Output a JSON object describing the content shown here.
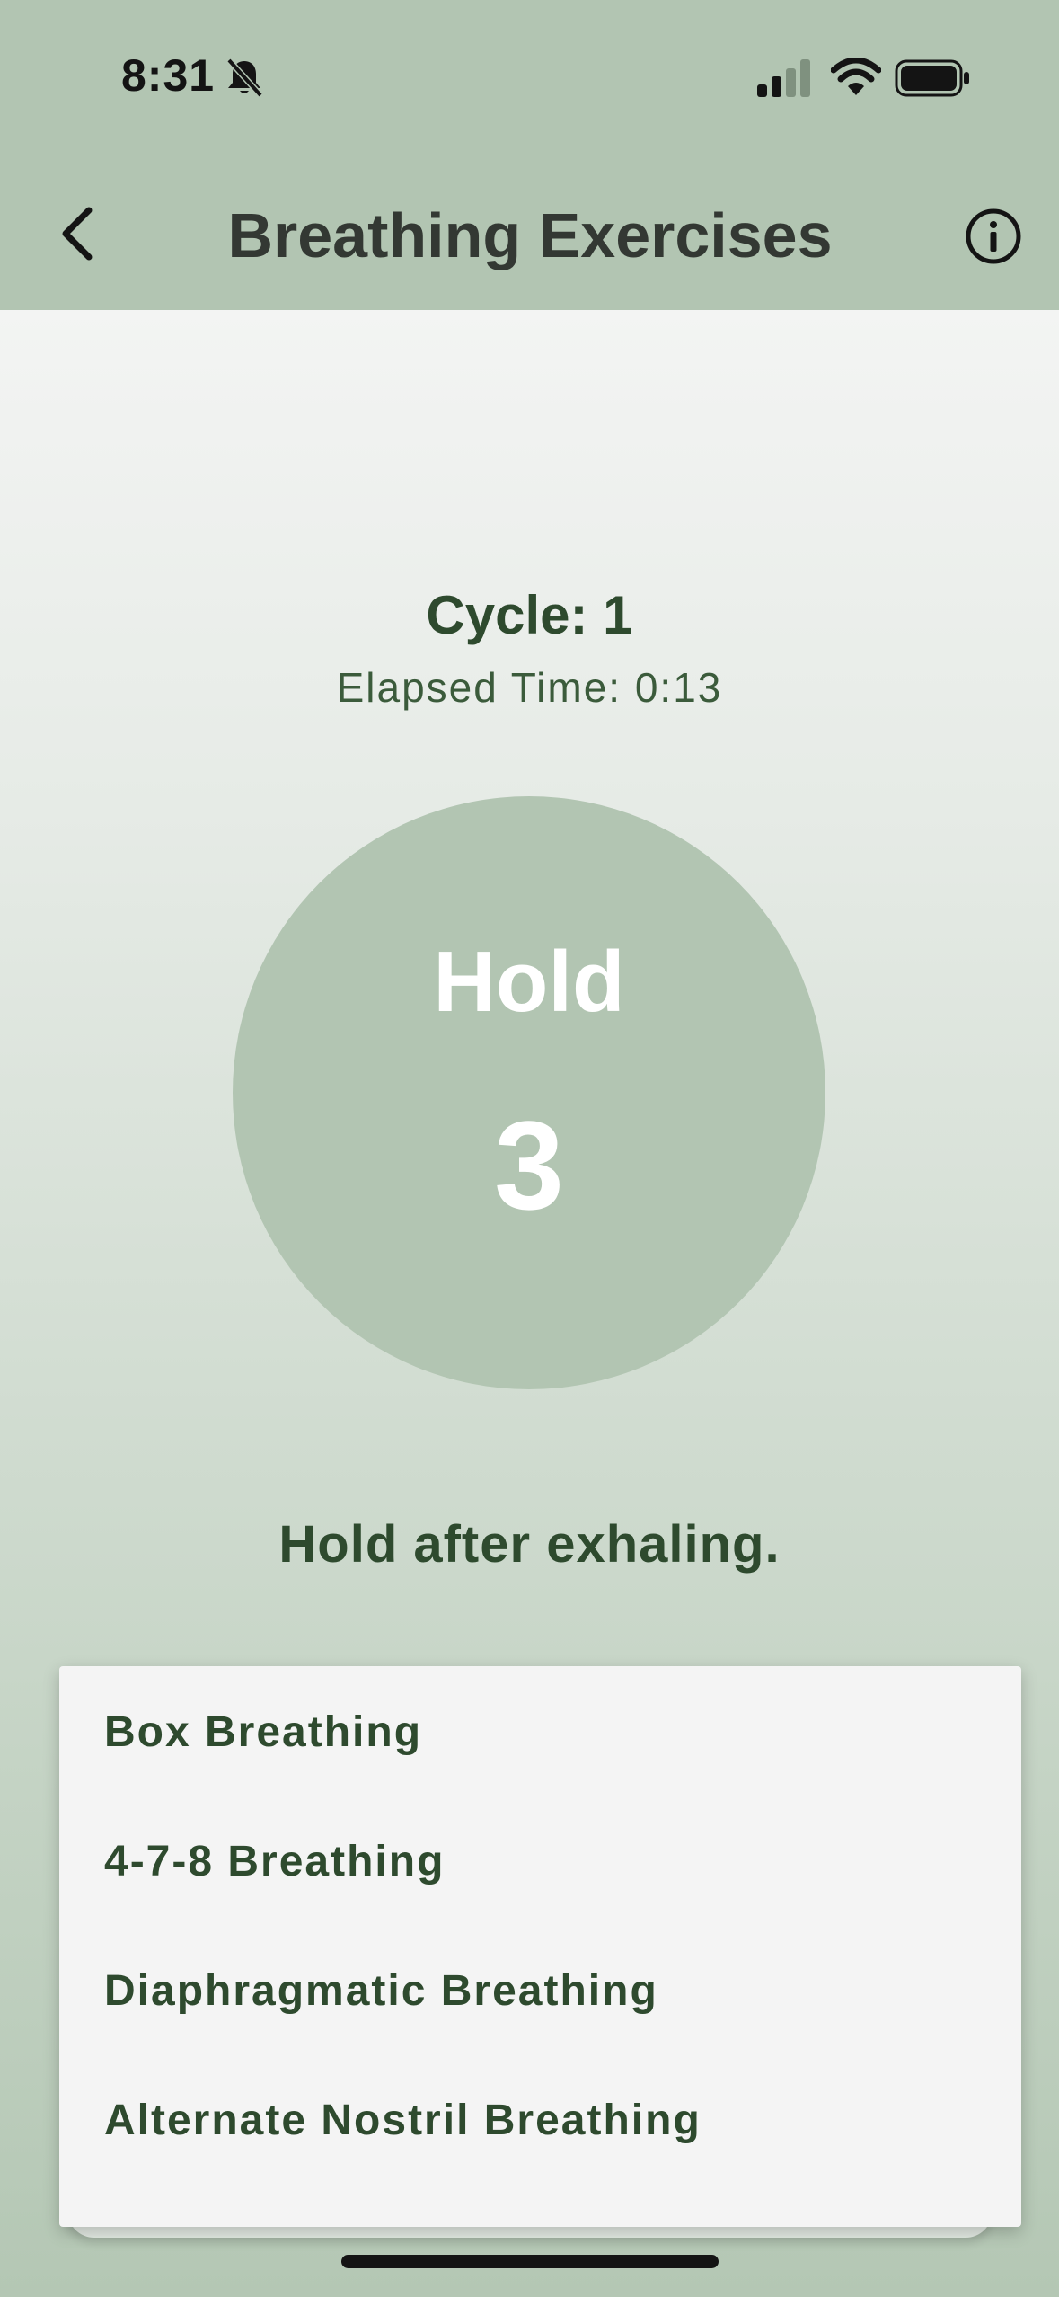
{
  "status_bar": {
    "time": "8:31",
    "icons": [
      "bell-slash-icon",
      "signal-icon",
      "wifi-icon",
      "battery-icon"
    ]
  },
  "header": {
    "title": "Breathing Exercises",
    "back_icon": "chevron-left-icon",
    "info_icon": "info-icon"
  },
  "session": {
    "cycle": "Cycle: 1",
    "elapsed": "Elapsed Time: 0:13"
  },
  "breath": {
    "phase": "Hold",
    "count": "3",
    "instruction": "Hold after exhaling."
  },
  "menu": {
    "items": [
      {
        "label": "Box Breathing"
      },
      {
        "label": "4-7-8 Breathing"
      },
      {
        "label": "Diaphragmatic Breathing"
      },
      {
        "label": "Alternate Nostril Breathing"
      }
    ]
  },
  "colors": {
    "header_bg": "#b2c5b2",
    "circle": "#b2c5b2",
    "accent_text": "#2e4a2e",
    "menu_bg": "#f4f4f4"
  }
}
